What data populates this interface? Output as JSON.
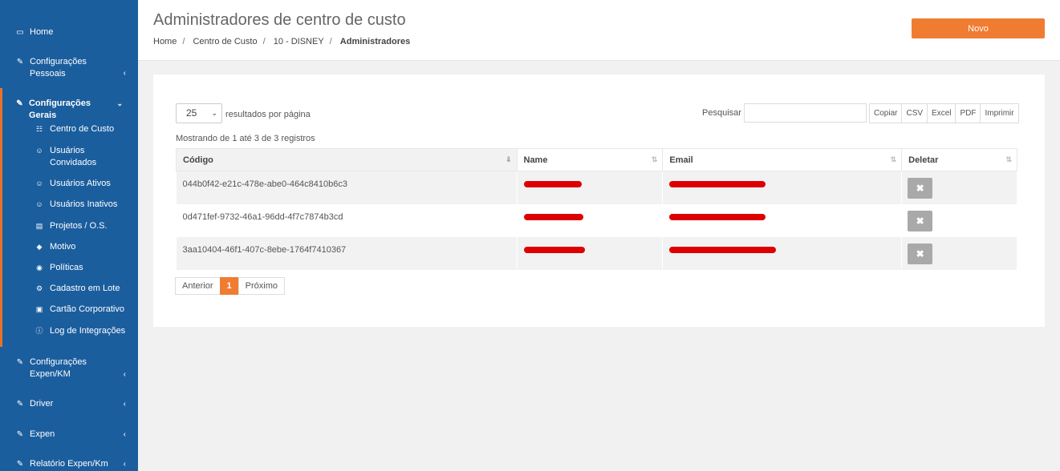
{
  "sidebar": {
    "items": [
      {
        "label": "Home",
        "icon": "laptop-icon"
      },
      {
        "label": "Configurações Pessoais",
        "icon": "edit-icon"
      },
      {
        "label": "Configurações Gerais",
        "icon": "edit-icon"
      },
      {
        "label": "Configurações Expen/KM",
        "icon": "edit-icon"
      },
      {
        "label": "Driver",
        "icon": "edit-icon"
      },
      {
        "label": "Expen",
        "icon": "edit-icon"
      },
      {
        "label": "Relatório Expen/Km",
        "icon": "edit-icon"
      }
    ],
    "submenu": [
      {
        "label": "Centro de Custo",
        "icon": "sitemap-icon"
      },
      {
        "label": "Usuários Convidados",
        "icon": "users-icon"
      },
      {
        "label": "Usuários Ativos",
        "icon": "users-icon"
      },
      {
        "label": "Usuários Inativos",
        "icon": "users-icon"
      },
      {
        "label": "Projetos / O.S.",
        "icon": "list-icon"
      },
      {
        "label": "Motivo",
        "icon": "tag-icon"
      },
      {
        "label": "Políticas",
        "icon": "policy-icon"
      },
      {
        "label": "Cadastro em Lote",
        "icon": "cogs-icon"
      },
      {
        "label": "Cartão Corporativo",
        "icon": "credit-card-icon"
      },
      {
        "label": "Log de Integrações",
        "icon": "info-icon"
      }
    ]
  },
  "header": {
    "title": "Administradores de centro de custo",
    "breadcrumb": [
      "Home",
      "Centro de Custo",
      "10 - DISNEY",
      "Administradores"
    ],
    "new_button": "Novo"
  },
  "table_controls": {
    "page_length": "25",
    "page_length_label": "resultados por página",
    "search_label": "Pesquisar",
    "search_value": "",
    "export_buttons": [
      "Copiar",
      "CSV",
      "Excel",
      "PDF",
      "Imprimir"
    ],
    "info": "Mostrando de 1 até 3 de 3 registros"
  },
  "table": {
    "columns": [
      "Código",
      "Name",
      "Email",
      "Deletar"
    ],
    "rows": [
      {
        "codigo": "044b0f42-e21c-478e-abe0-464c8410b6c3"
      },
      {
        "codigo": "0d471fef-9732-46a1-96dd-4f7c7874b3cd"
      },
      {
        "codigo": "3aa10404-46f1-407c-8ebe-1764f7410367"
      }
    ],
    "delete_icon": "close-icon"
  },
  "pagination": {
    "prev": "Anterior",
    "current": "1",
    "next": "Próximo"
  },
  "colors": {
    "sidebar_bg": "#1b5e9e",
    "accent": "#f07c32",
    "redaction": "#dd0000"
  }
}
